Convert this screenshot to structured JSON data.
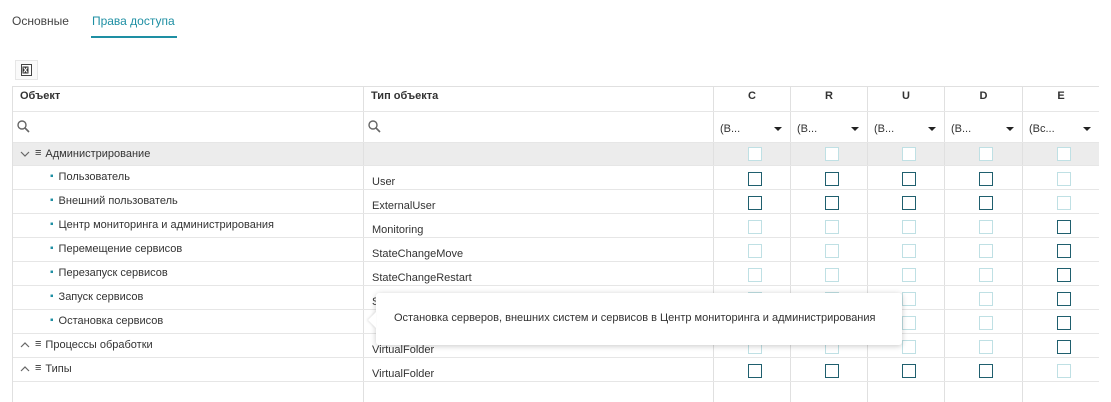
{
  "tabs": [
    {
      "label": "Основные",
      "active": false
    },
    {
      "label": "Права доступа",
      "active": true
    }
  ],
  "toolbar": {
    "export_icon": "excel-export-icon"
  },
  "columns": {
    "object": "Объект",
    "type": "Тип объекта",
    "c": "C",
    "r": "R",
    "u": "U",
    "d": "D",
    "e": "E"
  },
  "filters": {
    "c": "(В...",
    "r": "(В...",
    "u": "(В...",
    "d": "(В...",
    "e": "(Вс..."
  },
  "rows": [
    {
      "name": "Администрирование",
      "type": "",
      "group": true,
      "expanded": true
    },
    {
      "name": "Пользователь",
      "type": "User",
      "group": false
    },
    {
      "name": "Внешний пользователь",
      "type": "ExternalUser",
      "group": false
    },
    {
      "name": "Центр мониторинга и администрирования",
      "type": "Monitoring",
      "group": false
    },
    {
      "name": "Перемещение сервисов",
      "type": "StateChangeMove",
      "group": false
    },
    {
      "name": "Перезапуск сервисов",
      "type": "StateChangeRestart",
      "group": false
    },
    {
      "name": "Запуск сервисов",
      "type": "S",
      "group": false
    },
    {
      "name": "Остановка сервисов",
      "type": "",
      "group": false
    },
    {
      "name": "Процессы обработки",
      "type": "VirtualFolder",
      "group": true,
      "expanded": false
    },
    {
      "name": "Типы",
      "type": "VirtualFolder",
      "group": true,
      "expanded": false
    }
  ],
  "tooltip": {
    "text": "Остановка серверов, внешних систем и сервисов в Центр мониторинга и администрирования"
  },
  "colors": {
    "accent": "#1e8fa3",
    "checkbox_border": "#1f5f6e",
    "checkbox_disabled": "#bfe0e4",
    "group_bg": "#ececec"
  }
}
